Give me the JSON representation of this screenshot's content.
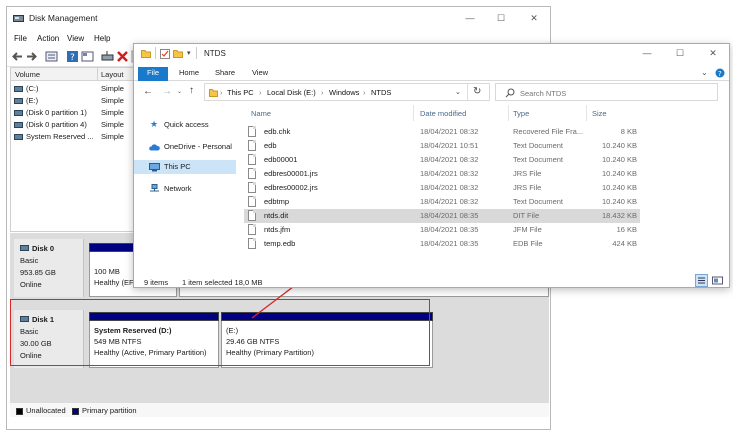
{
  "disk_management": {
    "title": "Disk Management",
    "menu": [
      "File",
      "Action",
      "View",
      "Help"
    ],
    "volume_columns": [
      "Volume",
      "Layout"
    ],
    "volumes": [
      {
        "name": "(C:)",
        "layout": "Simple"
      },
      {
        "name": "(E:)",
        "layout": "Simple"
      },
      {
        "name": "(Disk 0 partition 1)",
        "layout": "Simple"
      },
      {
        "name": "(Disk 0 partition 4)",
        "layout": "Simple"
      },
      {
        "name": "System Reserved ...",
        "layout": "Simple"
      }
    ],
    "disk0": {
      "name": "Disk 0",
      "type": "Basic",
      "size": "953.85 GB",
      "status": "Online",
      "partition": {
        "size": "100 MB",
        "status": "Healthy (EFI S"
      }
    },
    "disk1": {
      "name": "Disk 1",
      "type": "Basic",
      "size": "30.00 GB",
      "status": "Online",
      "partitions": [
        {
          "title": "System Reserved  (D:)",
          "size": "549 MB NTFS",
          "status": "Healthy (Active, Primary Partition)"
        },
        {
          "title": "(E:)",
          "size": "29.46 GB NTFS",
          "status": "Healthy (Primary Partition)"
        }
      ]
    },
    "legend": [
      {
        "label": "Unallocated",
        "color": "#000000"
      },
      {
        "label": "Primary partition",
        "color": "#000080"
      }
    ]
  },
  "explorer": {
    "title": "NTDS",
    "ribbon_tabs": [
      "File",
      "Home",
      "Share",
      "View"
    ],
    "breadcrumb": [
      "This PC",
      "Local Disk (E:)",
      "Windows",
      "NTDS"
    ],
    "search_placeholder": "Search NTDS",
    "nav": {
      "quick_access": "Quick access",
      "onedrive": "OneDrive - Personal",
      "this_pc": "This PC",
      "network": "Network"
    },
    "columns": {
      "name": "Name",
      "date": "Date modified",
      "type": "Type",
      "size": "Size"
    },
    "files": [
      {
        "name": "edb.chk",
        "date": "18/04/2021 08:32",
        "type": "Recovered File Fra...",
        "size": "8 KB"
      },
      {
        "name": "edb",
        "date": "18/04/2021 10:51",
        "type": "Text Document",
        "size": "10.240 KB"
      },
      {
        "name": "edb00001",
        "date": "18/04/2021 08:32",
        "type": "Text Document",
        "size": "10.240 KB"
      },
      {
        "name": "edbres00001.jrs",
        "date": "18/04/2021 08:32",
        "type": "JRS File",
        "size": "10.240 KB"
      },
      {
        "name": "edbres00002.jrs",
        "date": "18/04/2021 08:32",
        "type": "JRS File",
        "size": "10.240 KB"
      },
      {
        "name": "edbtmp",
        "date": "18/04/2021 08:32",
        "type": "Text Document",
        "size": "10.240 KB"
      },
      {
        "name": "ntds.dit",
        "date": "18/04/2021 08:35",
        "type": "DIT File",
        "size": "18.432 KB"
      },
      {
        "name": "ntds.jfm",
        "date": "18/04/2021 08:35",
        "type": "JFM File",
        "size": "16 KB"
      },
      {
        "name": "temp.edb",
        "date": "18/04/2021 08:35",
        "type": "EDB File",
        "size": "424 KB"
      }
    ],
    "status": {
      "items": "9 items",
      "selected": "1 item selected  18,0 MB"
    }
  },
  "colors": {
    "accent": "#1979ca",
    "partition_bar": "#000080",
    "highlight": "#d62828"
  }
}
